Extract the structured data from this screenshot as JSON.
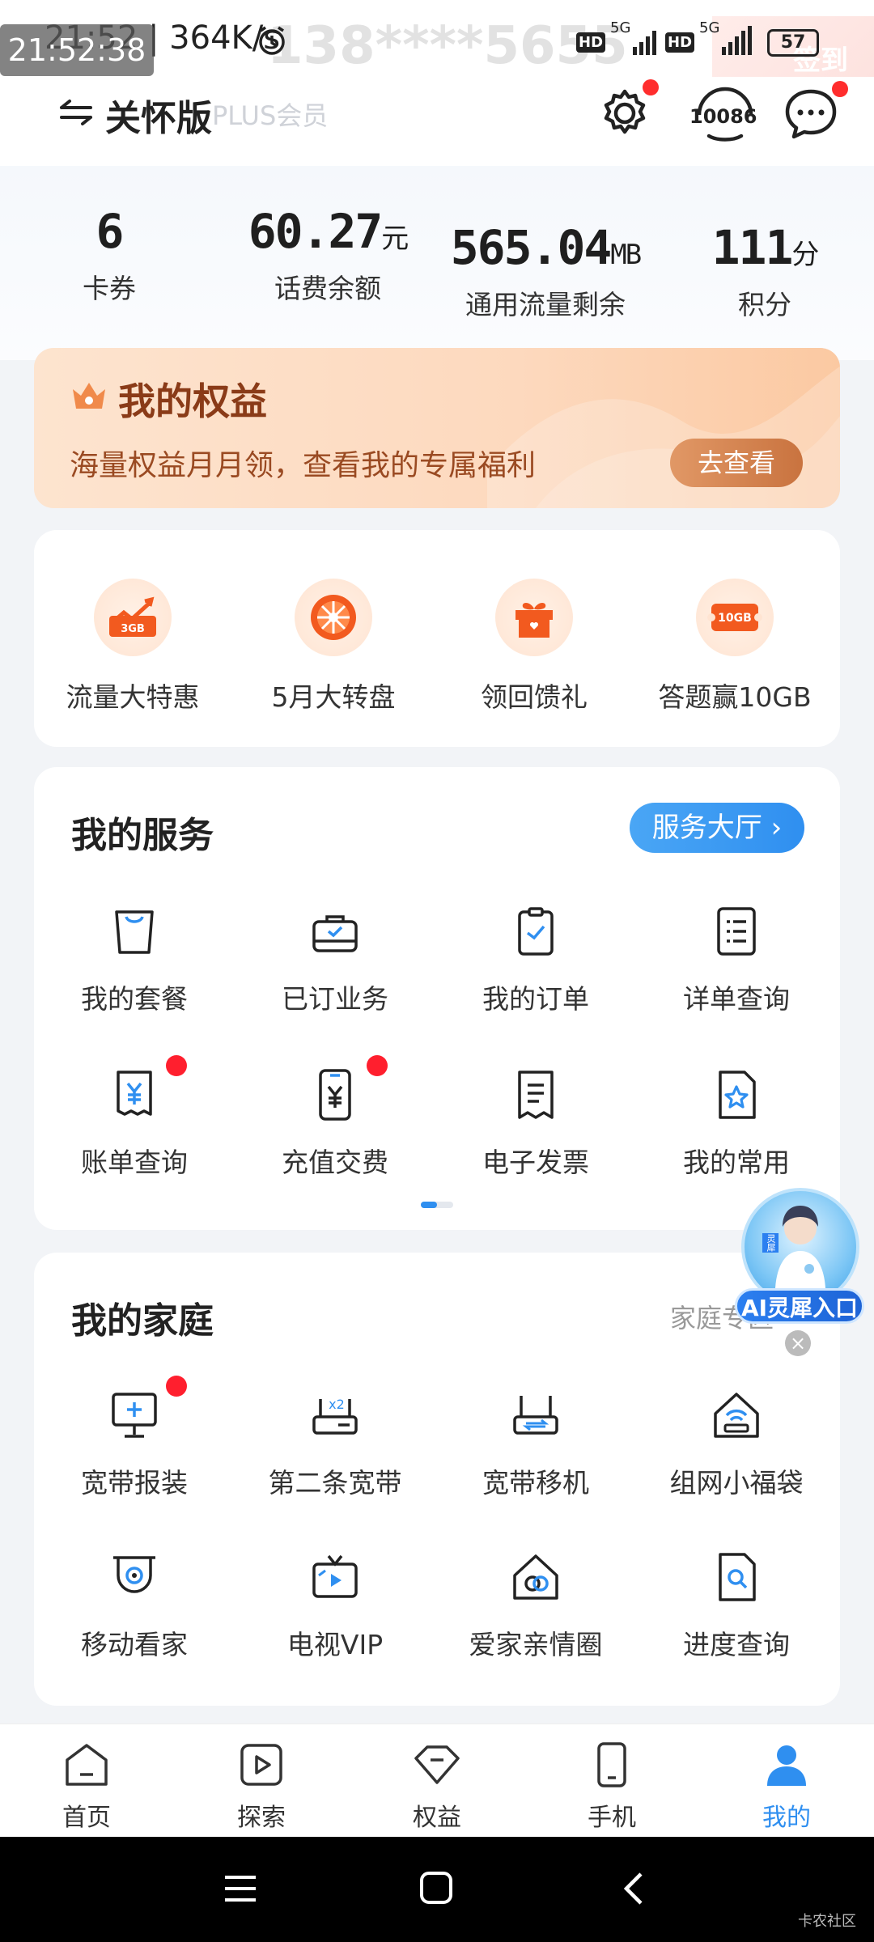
{
  "status_bar": {
    "time_overlay": "21:52:38",
    "time_speed": "21:52 | 364K/s",
    "signal1": "5G",
    "signal2": "5G",
    "hd1": "HD",
    "hd2": "HD",
    "battery": "57",
    "ghost_number": "138****5655",
    "ghost_member": "PLUS会员",
    "checkin_text": "签到"
  },
  "header": {
    "care_mode": "关怀版",
    "service_number": "10086"
  },
  "stats": [
    {
      "value": "6",
      "unit": "",
      "label": "卡券"
    },
    {
      "value": "60.27",
      "unit": "元",
      "label": "话费余额"
    },
    {
      "value": "565.04",
      "unit": "MB",
      "label": "通用流量剩余"
    },
    {
      "value": "111",
      "unit": "分",
      "label": "积分"
    }
  ],
  "benefit_banner": {
    "title": "我的权益",
    "subtitle": "海量权益月月领，查看我的专属福利",
    "button": "去查看"
  },
  "promos": [
    {
      "label": "流量大特惠",
      "icon": "traffic-chart-icon",
      "icon_text": "3GB"
    },
    {
      "label": "5月大转盘",
      "icon": "wheel-icon"
    },
    {
      "label": "领回馈礼",
      "icon": "gift-icon"
    },
    {
      "label": "答题赢10GB",
      "icon": "ticket-icon",
      "icon_text": "10GB"
    }
  ],
  "services": {
    "title": "我的服务",
    "hall_button": "服务大厅 ›",
    "items": [
      {
        "label": "我的套餐",
        "icon": "bag-icon"
      },
      {
        "label": "已订业务",
        "icon": "briefcase-check-icon"
      },
      {
        "label": "我的订单",
        "icon": "clipboard-check-icon"
      },
      {
        "label": "详单查询",
        "icon": "list-doc-icon"
      },
      {
        "label": "账单查询",
        "icon": "bill-yuan-icon",
        "badge": true
      },
      {
        "label": "充值交费",
        "icon": "phone-yuan-icon",
        "badge": true
      },
      {
        "label": "电子发票",
        "icon": "invoice-icon"
      },
      {
        "label": "我的常用",
        "icon": "star-doc-icon"
      }
    ]
  },
  "family": {
    "title": "我的家庭",
    "link": "家庭专区",
    "items": [
      {
        "label": "宽带报装",
        "icon": "monitor-plus-icon",
        "badge": true
      },
      {
        "label": "第二条宽带",
        "icon": "router-x2-icon",
        "icon_text": "x2"
      },
      {
        "label": "宽带移机",
        "icon": "router-move-icon"
      },
      {
        "label": "组网小福袋",
        "icon": "home-wifi-icon"
      },
      {
        "label": "移动看家",
        "icon": "camera-icon"
      },
      {
        "label": "电视VIP",
        "icon": "tv-play-icon"
      },
      {
        "label": "爱家亲情圈",
        "icon": "home-circle-icon"
      },
      {
        "label": "进度查询",
        "icon": "search-doc-icon"
      }
    ]
  },
  "ai_assistant": {
    "label": "AI灵犀入口",
    "badge_text": "灵犀"
  },
  "tabbar": [
    {
      "label": "首页",
      "icon": "home-icon",
      "active": false
    },
    {
      "label": "探索",
      "icon": "play-icon",
      "active": false
    },
    {
      "label": "权益",
      "icon": "diamond-icon",
      "active": false
    },
    {
      "label": "手机",
      "icon": "phone-icon",
      "active": false
    },
    {
      "label": "我的",
      "icon": "user-icon",
      "active": true
    }
  ],
  "watermark": "卡农社区",
  "colors": {
    "accent": "#2f8ff0",
    "badge_red": "#ff1f2e",
    "benefit_brown": "#8a3b18"
  }
}
